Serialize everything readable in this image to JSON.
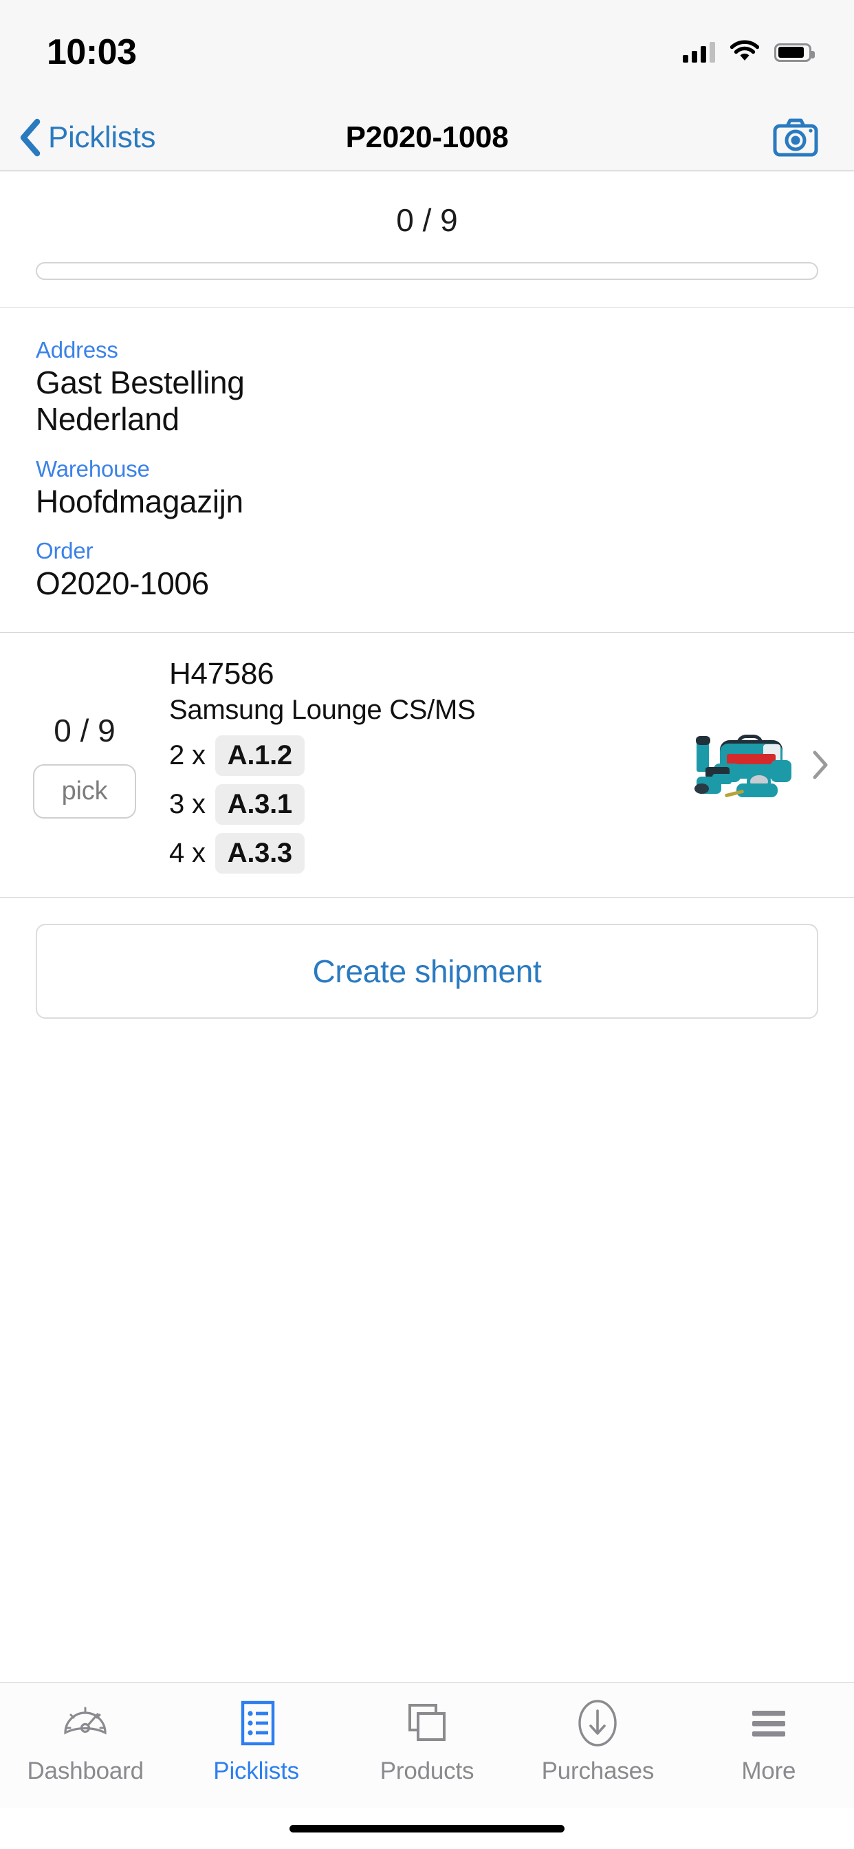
{
  "status_bar": {
    "time": "10:03",
    "signal_icon": "cellular-signal-icon",
    "signal_bars_filled": 3,
    "signal_bars_total": 4,
    "wifi_icon": "wifi-icon",
    "battery_icon": "battery-icon",
    "battery_level_percent": 88
  },
  "nav_bar": {
    "back_label": "Picklists",
    "back_icon": "chevron-left-icon",
    "title": "P2020-1008",
    "camera_icon": "camera-icon"
  },
  "progress": {
    "count_text": "0 / 9",
    "picked": 0,
    "total": 9,
    "percent": 0
  },
  "details": {
    "fields": [
      {
        "label": "Address",
        "value": "Gast Bestelling\nNederland"
      },
      {
        "label": "Warehouse",
        "value": "Hoofdmagazijn"
      },
      {
        "label": "Order",
        "value": "O2020-1006"
      }
    ]
  },
  "pick_lines": [
    {
      "count_text": "0 / 9",
      "pick_button_label": "pick",
      "sku": "H47586",
      "name": "Samsung Lounge CS/MS",
      "locations": [
        {
          "qty": "2 x",
          "location": "A.1.2"
        },
        {
          "qty": "3 x",
          "location": "A.3.1"
        },
        {
          "qty": "4 x",
          "location": "A.3.3"
        }
      ],
      "thumbnail_icon": "product-thumbnail-makita-tool-set",
      "chevron_icon": "chevron-right-icon"
    }
  ],
  "actions": {
    "create_shipment_label": "Create shipment"
  },
  "tab_bar": {
    "active_index": 1,
    "tabs": [
      {
        "label": "Dashboard",
        "icon": "gauge-icon"
      },
      {
        "label": "Picklists",
        "icon": "list-icon"
      },
      {
        "label": "Products",
        "icon": "stacked-squares-icon"
      },
      {
        "label": "Purchases",
        "icon": "download-circle-icon"
      },
      {
        "label": "More",
        "icon": "hamburger-icon"
      }
    ]
  },
  "colors": {
    "accent_blue": "#2a7ac0",
    "label_blue": "#3b82e8",
    "tab_active_blue": "#2d7ff0",
    "tab_inactive_gray": "#8a8a8f",
    "badge_gray": "#ededed"
  }
}
